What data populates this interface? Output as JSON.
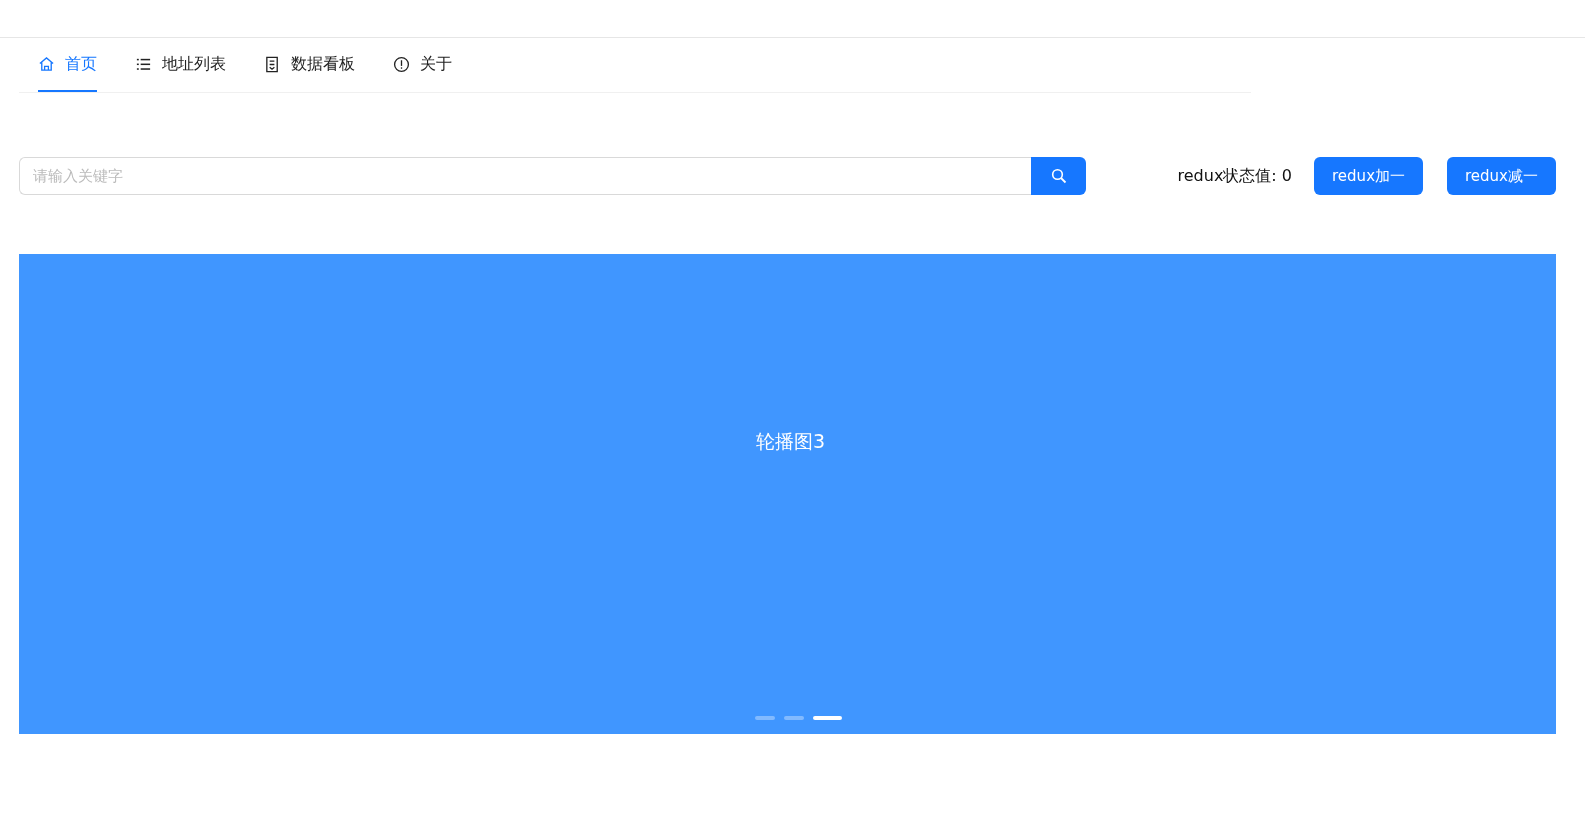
{
  "tabs": [
    {
      "label": "首页",
      "kind": "home",
      "selected": true
    },
    {
      "label": "地址列表",
      "kind": "list",
      "selected": false
    },
    {
      "label": "数据看板",
      "kind": "document",
      "selected": false
    },
    {
      "label": "关于",
      "kind": "info",
      "selected": false
    }
  ],
  "search": {
    "placeholder": "请输入关键字"
  },
  "counter": {
    "label": "redux状态值: 0"
  },
  "buttons": [
    "redux加一",
    "redux减一"
  ],
  "carousel": {
    "slide": "轮播图3",
    "dots": [
      {
        "selected": false
      },
      {
        "selected": false
      },
      {
        "selected": true
      }
    ]
  }
}
